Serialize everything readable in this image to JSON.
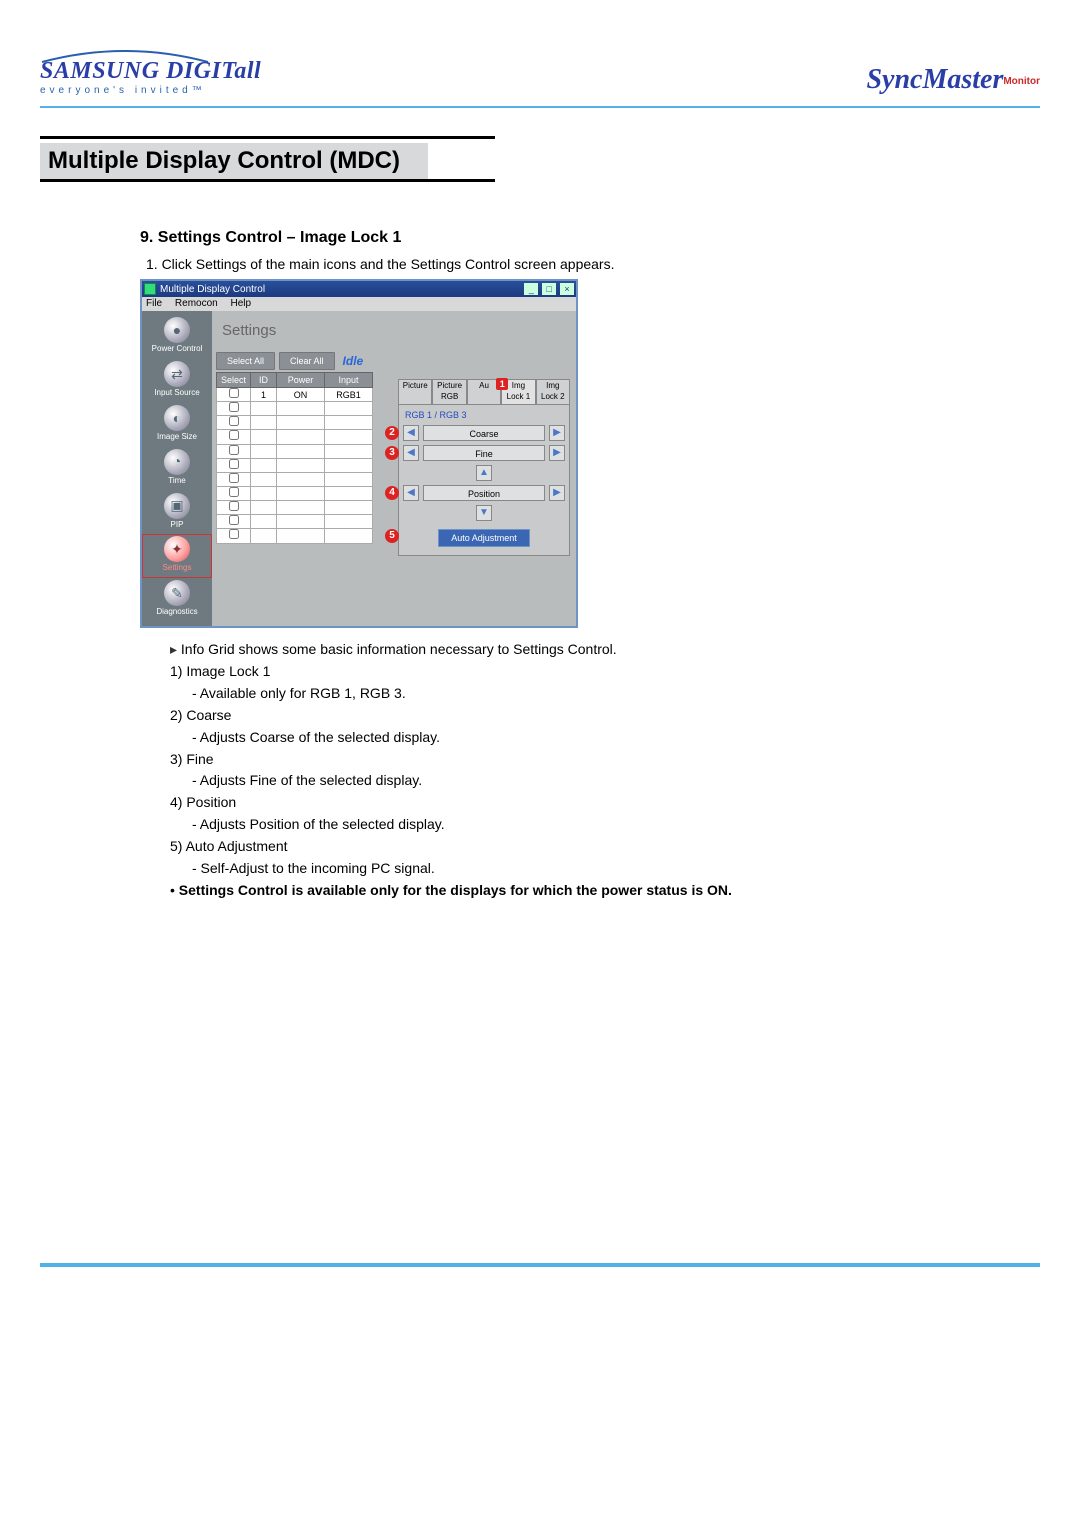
{
  "header": {
    "brand_top": "SAMSUNG DIGITall",
    "brand_tag": "everyone's invited™",
    "product": "SyncMaster",
    "product_sub": "Monitor"
  },
  "page_title": "Multiple Display Control (MDC)",
  "section_heading": "9. Settings Control – Image Lock 1",
  "step1": "1. Click Settings of the main icons and the Settings Control screen appears.",
  "app": {
    "title": "Multiple Display Control",
    "menu": {
      "file": "File",
      "remocon": "Remocon",
      "help": "Help"
    },
    "sidebar": [
      {
        "label": "Power Control",
        "icon": "●"
      },
      {
        "label": "Input Source",
        "icon": "⇄"
      },
      {
        "label": "Image Size",
        "icon": "◐"
      },
      {
        "label": "Time",
        "icon": "◔"
      },
      {
        "label": "PIP",
        "icon": "▣"
      },
      {
        "label": "Settings",
        "icon": "✦",
        "selected": true
      },
      {
        "label": "Diagnostics",
        "icon": "✎"
      }
    ],
    "main_title": "Settings",
    "buttons": {
      "select_all": "Select All",
      "clear_all": "Clear All"
    },
    "idle": "Idle",
    "cols": {
      "select": "Select",
      "id": "ID",
      "power": "Power",
      "input": "Input"
    },
    "row1": {
      "id": "1",
      "power": "ON",
      "input": "RGB1"
    },
    "tabs": {
      "picture": "Picture",
      "picture_rgb": "Picture RGB",
      "audio": "Au",
      "img1": "Img Lock 1",
      "img2": "Img Lock 2"
    },
    "callout1": "1",
    "rgb_line": "RGB 1 / RGB 3",
    "controls": {
      "c2": {
        "num": "2",
        "label": "Coarse"
      },
      "c3": {
        "num": "3",
        "label": "Fine"
      },
      "c4": {
        "num": "4",
        "label": "Position"
      },
      "c5": {
        "num": "5",
        "label": "Auto Adjustment"
      }
    }
  },
  "notes": {
    "lead": "Info Grid shows some basic information necessary to Settings Control.",
    "n1a": "1) Image Lock 1",
    "n1b": "- Available only for RGB 1, RGB 3.",
    "n2a": "2) Coarse",
    "n2b": "- Adjusts Coarse of the selected display.",
    "n3a": "3) Fine",
    "n3b": "- Adjusts Fine of the selected display.",
    "n4a": "4) Position",
    "n4b": "- Adjusts Position of the selected display.",
    "n5a": "5) Auto Adjustment",
    "n5b": "- Self-Adjust to the incoming PC signal.",
    "bullet": "Settings Control is available only for the displays for which the power status is ON."
  }
}
